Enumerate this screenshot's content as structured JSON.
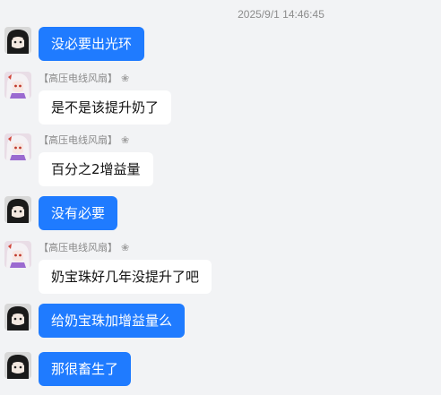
{
  "conversation": {
    "timestamp": "2025/9/1 14:46:45",
    "messages": [
      {
        "side": "mine",
        "text": "没必要出光环"
      },
      {
        "side": "theirs",
        "sender": "【高压电线风扇】",
        "text": "是不是该提升奶了"
      },
      {
        "side": "theirs",
        "sender": "【高压电线风扇】",
        "text": "百分之2增益量"
      },
      {
        "side": "mine",
        "text": "没有必要"
      },
      {
        "side": "theirs",
        "sender": "【高压电线风扇】",
        "text": "奶宝珠好几年没提升了吧"
      },
      {
        "side": "mine",
        "text": "给奶宝珠加增益量么"
      },
      {
        "side": "mine",
        "text": "那很畜生了"
      }
    ]
  },
  "icons": {
    "my_avatar": "dark-hair-character-avatar",
    "their_avatar": "white-hair-character-avatar",
    "sender_badge": "flower-badge-icon",
    "sender_badge_glyph": "❀"
  },
  "colors": {
    "background": "#f2f3f5",
    "my_bubble": "#1f7bff",
    "their_bubble": "#ffffff",
    "timestamp_text": "#8c8c8c"
  }
}
